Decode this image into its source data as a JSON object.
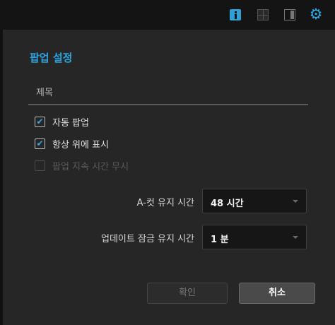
{
  "toolbar": {
    "icons": [
      "info-icon",
      "grid-icon",
      "panel-icon",
      "gear-icon"
    ],
    "accent_color": "#2fa9e6"
  },
  "dialog": {
    "title": "팝업 설정",
    "title_field": {
      "placeholder": "제목",
      "value": ""
    },
    "options": [
      {
        "label": "자동 팝업",
        "checked": true,
        "disabled": false
      },
      {
        "label": "항상 위에 표시",
        "checked": true,
        "disabled": false
      },
      {
        "label": "팝업 지속 시간 무시",
        "checked": false,
        "disabled": true
      }
    ],
    "a_cut_label": "A-컷 유지 시간",
    "a_cut_value": "48 시간",
    "update_lock_label": "업데이트 잠금 유지 시간",
    "update_lock_value": "1 분",
    "ok_label": "확인",
    "cancel_label": "취소"
  }
}
